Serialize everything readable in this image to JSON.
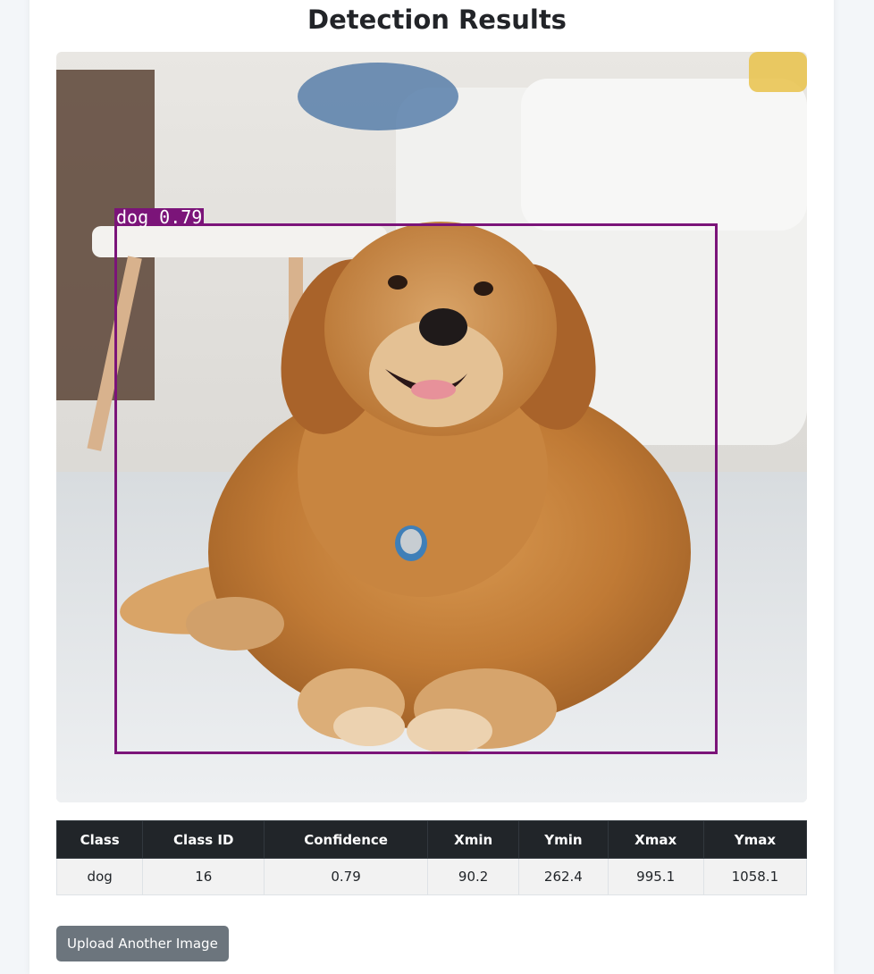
{
  "page_title": "Detection Results",
  "detection_label": "dog 0.79",
  "box_color": "#7b1479",
  "table": {
    "headers": [
      "Class",
      "Class ID",
      "Confidence",
      "Xmin",
      "Ymin",
      "Xmax",
      "Ymax"
    ],
    "rows": [
      [
        "dog",
        "16",
        "0.79",
        "90.2",
        "262.4",
        "995.1",
        "1058.1"
      ]
    ]
  },
  "upload_button_label": "Upload Another Image"
}
